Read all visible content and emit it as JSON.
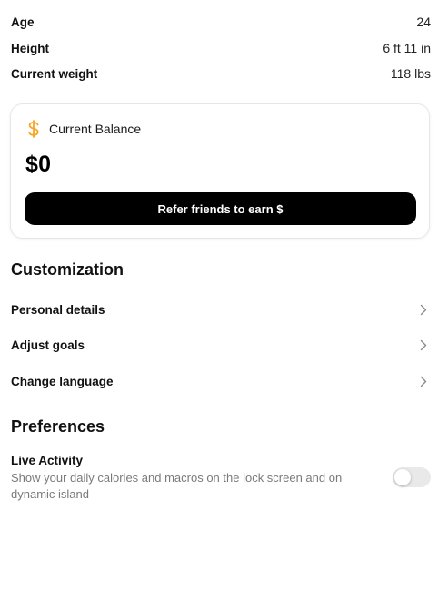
{
  "profile": {
    "age": {
      "label": "Age",
      "value": "24"
    },
    "height": {
      "label": "Height",
      "value": "6 ft 11 in"
    },
    "weight": {
      "label": "Current weight",
      "value": "118 lbs"
    }
  },
  "balance": {
    "icon": "dollar-icon",
    "title": "Current Balance",
    "amount": "$0",
    "button_label": "Refer friends to earn $",
    "accent_color": "#f5a524"
  },
  "customization": {
    "title": "Customization",
    "items": [
      {
        "label": "Personal details",
        "icon": "chevron-right-icon"
      },
      {
        "label": "Adjust goals",
        "icon": "chevron-right-icon"
      },
      {
        "label": "Change language",
        "icon": "chevron-right-icon"
      }
    ]
  },
  "preferences": {
    "title": "Preferences",
    "live_activity": {
      "title": "Live Activity",
      "description": "Show your daily calories and macros on the lock screen and on dynamic island",
      "enabled": false
    }
  }
}
